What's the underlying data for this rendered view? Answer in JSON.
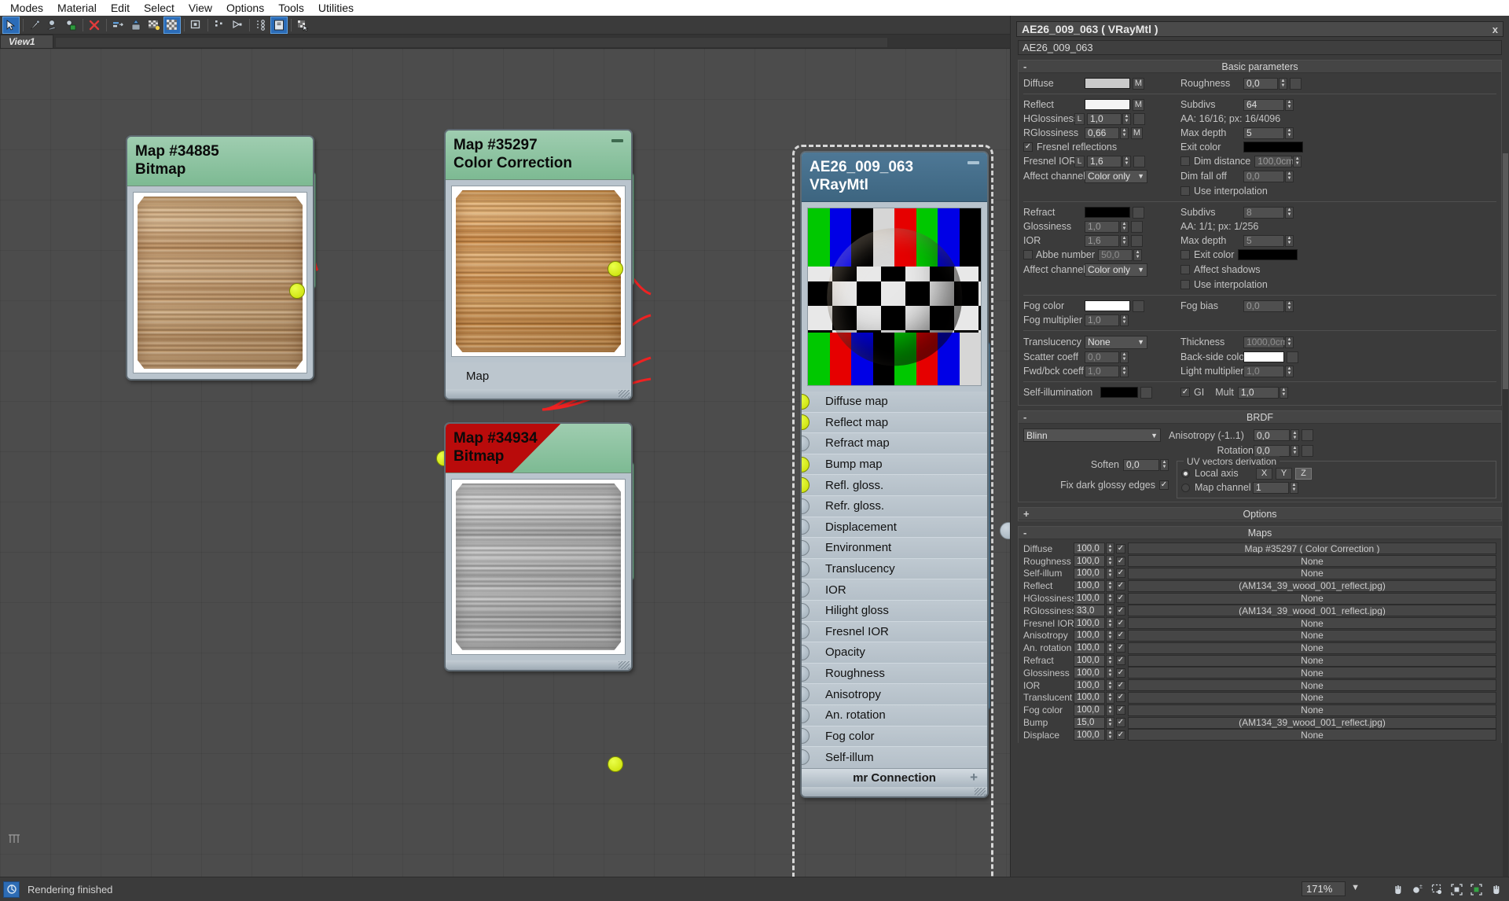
{
  "menu": {
    "items": [
      "Modes",
      "Material",
      "Edit",
      "Select",
      "View",
      "Options",
      "Tools",
      "Utilities"
    ]
  },
  "toolbar": {
    "icons": [
      {
        "name": "select-pointer-icon",
        "glyph": "➤",
        "active": true
      },
      {
        "name": "pick-material-icon",
        "glyph": "✐",
        "active": false
      },
      {
        "name": "assign-material-to-selection-icon",
        "glyph": "●",
        "active": false
      },
      {
        "name": "show-shaded-material-in-viewport-icon",
        "glyph": "▣",
        "active": false
      },
      {
        "name": "delete-icon",
        "glyph": "✕",
        "active": false
      },
      {
        "name": "move-children-icon",
        "glyph": "⇨",
        "active": false
      },
      {
        "name": "put-material-to-library-icon",
        "glyph": "⬆",
        "active": false
      },
      {
        "name": "material-id-channel-icon",
        "glyph": "▒",
        "active": false
      },
      {
        "name": "show-background-checker-icon",
        "glyph": "▦",
        "active": true
      },
      {
        "name": "show-end-result-icon",
        "glyph": "□",
        "active": false
      },
      {
        "name": "layout-children-icon",
        "glyph": "∴",
        "active": false
      },
      {
        "name": "layout-all-icon",
        "glyph": "⊳",
        "active": false
      },
      {
        "name": "move-children-tree-icon",
        "glyph": "⁘",
        "active": false
      },
      {
        "name": "material-parameter-editor-icon",
        "glyph": "▤",
        "active": true
      },
      {
        "name": "select-by-material-icon",
        "glyph": "⁂",
        "active": false
      }
    ],
    "view_selector": "View 1"
  },
  "viewtab": {
    "label": "View1"
  },
  "nodes": {
    "bitmap_diffuse": {
      "id_label": "Map #34885",
      "type_label": "Bitmap",
      "flagged": false,
      "minimize": false
    },
    "color_correction": {
      "id_label": "Map #35297",
      "type_label": "Color Correction",
      "flagged": false,
      "minimize": true,
      "input_slot": "Map"
    },
    "bitmap_bump": {
      "id_label": "Map #34934",
      "type_label": "Bitmap",
      "flagged": true,
      "minimize": false
    },
    "material": {
      "id_label": "AE26_009_063",
      "type_label": "VRayMtl",
      "minimize": true,
      "footer": "mr Connection",
      "footer_sign": "+",
      "slots": [
        {
          "label": "Diffuse map",
          "connected": true
        },
        {
          "label": "Reflect map",
          "connected": true
        },
        {
          "label": "Refract map",
          "connected": false
        },
        {
          "label": "Bump map",
          "connected": true
        },
        {
          "label": "Refl. gloss.",
          "connected": true
        },
        {
          "label": "Refr. gloss.",
          "connected": false
        },
        {
          "label": "Displacement",
          "connected": false
        },
        {
          "label": "Environment",
          "connected": false
        },
        {
          "label": "Translucency",
          "connected": false
        },
        {
          "label": "IOR",
          "connected": false
        },
        {
          "label": "Hilight gloss",
          "connected": false
        },
        {
          "label": "Fresnel IOR",
          "connected": false
        },
        {
          "label": "Opacity",
          "connected": false
        },
        {
          "label": "Roughness",
          "connected": false
        },
        {
          "label": "Anisotropy",
          "connected": false
        },
        {
          "label": "An. rotation",
          "connected": false
        },
        {
          "label": "Fog color",
          "connected": false
        },
        {
          "label": "Self-illum",
          "connected": false
        }
      ]
    }
  },
  "panel": {
    "title": "AE26_009_063  ( VRayMtl )",
    "close_label": "x",
    "name_field": "AE26_009_063",
    "rollouts": {
      "basic": {
        "sign": "-",
        "label": "Basic parameters"
      },
      "brdf": {
        "sign": "-",
        "label": "BRDF"
      },
      "options": {
        "sign": "+",
        "label": "Options"
      },
      "maps": {
        "sign": "-",
        "label": "Maps"
      }
    },
    "basic": {
      "diffuse_label": "Diffuse",
      "diffuse_color": "#c9c9c9",
      "diffuse_m": "M",
      "roughness_label": "Roughness",
      "roughness_value": "0,0",
      "reflect_label": "Reflect",
      "reflect_color": "#f4f4f4",
      "reflect_m": "M",
      "subdivs_label": "Subdivs",
      "subdivs_value": "64",
      "hglossiness_label": "HGlossiness",
      "hglossiness_l": "L",
      "hglossiness_value": "1,0",
      "aa_refl": "AA: 16/16; px: 16/4096",
      "rglossiness_label": "RGlossiness",
      "rglossiness_value": "0,66",
      "rglossiness_m": "M",
      "maxdepth_label": "Max depth",
      "maxdepth_value": "5",
      "fresnel_reflections_label": "Fresnel reflections",
      "fresnel_reflections_checked": true,
      "exit_color_label": "Exit color",
      "exit_color": "#000000",
      "fresnel_ior_label": "Fresnel IOR",
      "fresnel_ior_l": "L",
      "fresnel_ior_value": "1,6",
      "dim_distance_label": "Dim distance",
      "dim_distance_checked": false,
      "dim_distance_value": "100,0cm",
      "affect_channels_label": "Affect channels",
      "affect_channels_value": "Color only",
      "dim_falloff_label": "Dim fall off",
      "dim_falloff_value": "0,0",
      "use_interpolation_label": "Use interpolation",
      "use_interpolation_checked": false
    },
    "refract": {
      "refract_label": "Refract",
      "refract_color": "#000000",
      "subdivs_label": "Subdivs",
      "subdivs_value": "8",
      "glossiness_label": "Glossiness",
      "glossiness_value": "1,0",
      "aa_refr": "AA: 1/1; px: 1/256",
      "ior_label": "IOR",
      "ior_value": "1,6",
      "maxdepth_label": "Max depth",
      "maxdepth_value": "5",
      "abbe_label": "Abbe number",
      "abbe_checked": false,
      "abbe_value": "50,0",
      "exit_color_label": "Exit color",
      "exit_color_checked": false,
      "exit_color": "#000000",
      "affect_channels_label": "Affect channels",
      "affect_channels_value": "Color only",
      "affect_shadows_label": "Affect shadows",
      "affect_shadows_checked": false,
      "use_interpolation_label": "Use interpolation",
      "use_interpolation_checked": false,
      "fog_color_label": "Fog color",
      "fog_color": "#ffffff",
      "fog_bias_label": "Fog bias",
      "fog_bias_value": "0,0",
      "fog_multiplier_label": "Fog multiplier",
      "fog_multiplier_value": "1,0"
    },
    "translucency": {
      "translucency_label": "Translucency",
      "translucency_value": "None",
      "thickness_label": "Thickness",
      "thickness_value": "1000,0cm",
      "scatter_label": "Scatter coeff",
      "scatter_value": "0,0",
      "backside_label": "Back-side color",
      "backside_color": "#ffffff",
      "fwdbck_label": "Fwd/bck coeff",
      "fwdbck_value": "1,0",
      "light_mult_label": "Light multiplier",
      "light_mult_value": "1,0",
      "selfillum_label": "Self-illumination",
      "selfillum_color": "#000000",
      "gi_label": "GI",
      "gi_checked": true,
      "mult_label": "Mult",
      "mult_value": "1,0"
    },
    "brdf": {
      "type_value": "Blinn",
      "anisotropy_label": "Anisotropy (-1..1)",
      "anisotropy_value": "0,0",
      "rotation_label": "Rotation",
      "rotation_value": "0,0",
      "soften_label": "Soften",
      "soften_value": "0,0",
      "uv_group_label": "UV vectors derivation",
      "local_axis_label": "Local axis",
      "local_axis_selected": true,
      "axis_x": "X",
      "axis_y": "Y",
      "axis_z": "Z",
      "axis_active": "Z",
      "map_channel_label": "Map channel",
      "map_channel_selected": false,
      "map_channel_value": "1",
      "fix_dark_label": "Fix dark glossy edges",
      "fix_dark_checked": true
    },
    "maps": [
      {
        "label": "Diffuse",
        "amount": "100,0",
        "enabled": true,
        "target": "Map #35297  ( Color Correction )"
      },
      {
        "label": "Roughness",
        "amount": "100,0",
        "enabled": true,
        "target": "None"
      },
      {
        "label": "Self-illum",
        "amount": "100,0",
        "enabled": true,
        "target": "None"
      },
      {
        "label": "Reflect",
        "amount": "100,0",
        "enabled": true,
        "target": "(AM134_39_wood_001_reflect.jpg)"
      },
      {
        "label": "HGlossiness",
        "amount": "100,0",
        "enabled": true,
        "target": "None"
      },
      {
        "label": "RGlossiness",
        "amount": "33,0",
        "enabled": true,
        "target": "(AM134_39_wood_001_reflect.jpg)"
      },
      {
        "label": "Fresnel IOR",
        "amount": "100,0",
        "enabled": true,
        "target": "None"
      },
      {
        "label": "Anisotropy",
        "amount": "100,0",
        "enabled": true,
        "target": "None"
      },
      {
        "label": "An. rotation",
        "amount": "100,0",
        "enabled": true,
        "target": "None"
      },
      {
        "label": "Refract",
        "amount": "100,0",
        "enabled": true,
        "target": "None"
      },
      {
        "label": "Glossiness",
        "amount": "100,0",
        "enabled": true,
        "target": "None"
      },
      {
        "label": "IOR",
        "amount": "100,0",
        "enabled": true,
        "target": "None"
      },
      {
        "label": "Translucent",
        "amount": "100,0",
        "enabled": true,
        "target": "None"
      },
      {
        "label": "Fog color",
        "amount": "100,0",
        "enabled": true,
        "target": "None"
      },
      {
        "label": "Bump",
        "amount": "15,0",
        "enabled": true,
        "target": "(AM134_39_wood_001_reflect.jpg)"
      },
      {
        "label": "Displace",
        "amount": "100,0",
        "enabled": true,
        "target": "None"
      }
    ]
  },
  "statusbar": {
    "message": "Rendering finished",
    "zoom": "171%",
    "nav_icons": [
      {
        "name": "pan-icon",
        "glyph": "✋"
      },
      {
        "name": "zoom-icon",
        "glyph": "●"
      },
      {
        "name": "zoom-region-icon",
        "glyph": "⬚"
      },
      {
        "name": "zoom-extents-icon",
        "glyph": "■"
      },
      {
        "name": "zoom-extents-selected-icon",
        "glyph": "▣"
      },
      {
        "name": "pan-hand-alt-icon",
        "glyph": "✋"
      }
    ]
  },
  "colors": {
    "map_header": "#7dba93",
    "mtl_header": "#3d6580",
    "flag_red": "#b90b0b",
    "wire": "#ee2222",
    "socket_on": "#d9f000",
    "socket_off": "#b4c0ca"
  }
}
